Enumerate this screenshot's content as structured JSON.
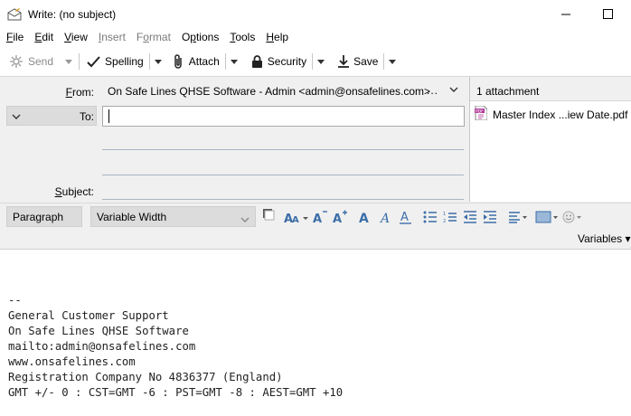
{
  "window": {
    "title": "Write: (no subject)",
    "icon": "compose-envelope-icon"
  },
  "menu": {
    "items": [
      {
        "label": "File",
        "accel": "F",
        "rest": "ile",
        "enabled": true
      },
      {
        "label": "Edit",
        "accel": "E",
        "rest": "dit",
        "enabled": true
      },
      {
        "label": "View",
        "accel": "V",
        "rest": "iew",
        "enabled": true
      },
      {
        "label": "Insert",
        "accel": "I",
        "rest": "nsert",
        "enabled": false
      },
      {
        "label": "Format",
        "accel": "o",
        "pre": "F",
        "rest": "rmat",
        "enabled": false
      },
      {
        "label": "Options",
        "accel": "p",
        "pre": "O",
        "rest": "tions",
        "enabled": true
      },
      {
        "label": "Tools",
        "accel": "T",
        "rest": "ools",
        "enabled": true
      },
      {
        "label": "Help",
        "accel": "H",
        "rest": "elp",
        "enabled": true
      }
    ]
  },
  "toolbar": {
    "send": "Send",
    "spelling": "Spelling",
    "attach": "Attach",
    "security": "Security",
    "save": "Save"
  },
  "header": {
    "from_label": "From:",
    "from_value": "On Safe Lines QHSE Software - Admin <admin@onsafelines.com>",
    "from_more": "...",
    "to_label": "To:",
    "to_value": "",
    "subject_label": "Subject:",
    "subject_value": ""
  },
  "attachments": {
    "count_label": "1 attachment",
    "items": [
      {
        "name": "Master Index ...iew Date.pdf",
        "icon": "pdf-file-icon"
      }
    ]
  },
  "format": {
    "paragraph": "Paragraph",
    "font": "Variable Width",
    "variables": "Variables"
  },
  "body": {
    "signature": "--\nGeneral Customer Support\nOn Safe Lines QHSE Software\nmailto:admin@onsafelines.com\nwww.onsafelines.com\nRegistration Company No 4836377 (England)\nGMT +/- 0 : CST=GMT -6 : PST=GMT -8 : AEST=GMT +10"
  },
  "colors": {
    "chrome": "#f0f0f0",
    "field_border": "#a9a9a9",
    "line": "#aab4c3",
    "icon_blue": "#3c6ea8"
  }
}
